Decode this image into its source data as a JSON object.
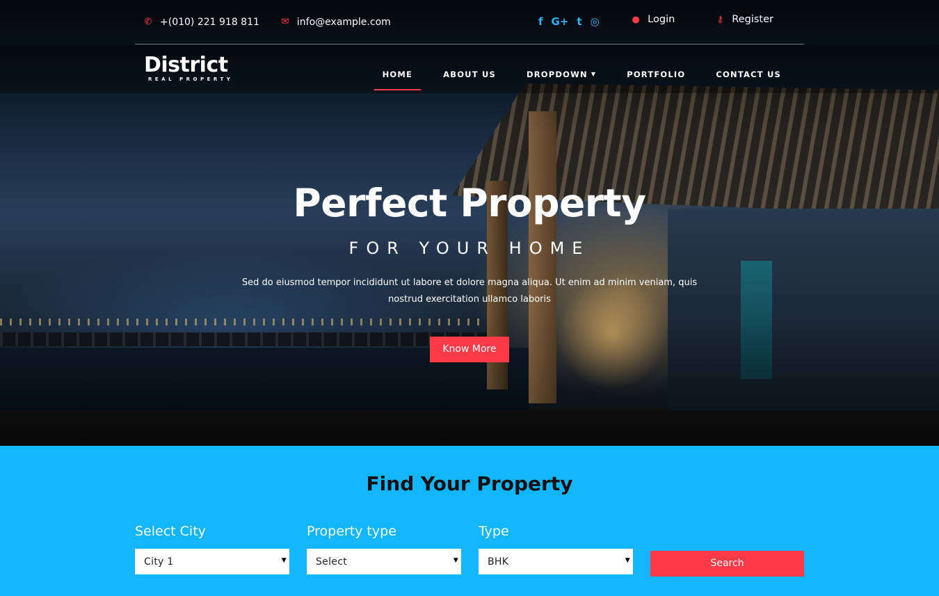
{
  "topbar": {
    "phone": "+(010) 221 918 811",
    "email": "info@example.com",
    "social": [
      "f",
      "G+",
      "t",
      "◎"
    ],
    "login": "Login",
    "register": "Register"
  },
  "brand": {
    "name": "District",
    "tagline": "REAL PROPERTY"
  },
  "nav": {
    "items": [
      {
        "label": "HOME"
      },
      {
        "label": "ABOUT US"
      },
      {
        "label": "DROPDOWN"
      },
      {
        "label": "PORTFOLIO"
      },
      {
        "label": "CONTACT US"
      }
    ]
  },
  "hero": {
    "title": "Perfect Property",
    "subtitle": "FOR YOUR HOME",
    "description": "Sed do eiusmod tempor incididunt ut labore et dolore magna aliqua. Ut enim ad minim veniam, quis nostrud exercitation ullamco laboris",
    "cta": "Know More"
  },
  "search": {
    "title": "Find Your Property",
    "fields": [
      {
        "label": "Select City",
        "value": "City 1"
      },
      {
        "label": "Property type",
        "value": "Select"
      },
      {
        "label": "Type",
        "value": "BHK"
      }
    ],
    "button": "Search"
  },
  "colors": {
    "accent": "#ff3b47",
    "search_bg": "#12b6ff",
    "social": "#2ab4ff"
  }
}
